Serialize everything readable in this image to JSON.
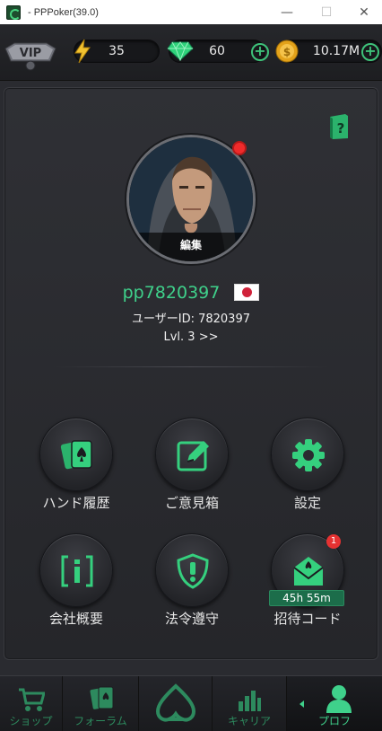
{
  "window": {
    "title": "- PPPoker(39.0)",
    "minimize_glyph": "—",
    "maximize_glyph": "☐",
    "close_glyph": "✕"
  },
  "resources": {
    "vip_label": "VIP",
    "energy": "35",
    "gems": "60",
    "coins": "10.17M",
    "plus_glyph": "+"
  },
  "profile": {
    "edit_label": "編集",
    "username": "pp7820397",
    "country_flag": "japan-flag",
    "user_id": "ユーザーID: 7820397",
    "level": "Lvl. 3 >>"
  },
  "menu": {
    "items": [
      {
        "label": "ハンド履歴",
        "icon": "cards-icon"
      },
      {
        "label": "ご意見箱",
        "icon": "feedback-edit-icon"
      },
      {
        "label": "設定",
        "icon": "gear-icon"
      },
      {
        "label": "会社概要",
        "icon": "info-icon"
      },
      {
        "label": "法令遵守",
        "icon": "shield-alert-icon"
      },
      {
        "label": "招待コード",
        "icon": "invite-envelope-icon"
      }
    ],
    "invite_badge": "1",
    "invite_timer": "45h 55m"
  },
  "bottom_nav": {
    "items": [
      {
        "label": "ショップ",
        "icon": "cart-icon"
      },
      {
        "label": "フォーラム",
        "icon": "forum-cards-icon"
      },
      {
        "label": "",
        "icon": "spade-logo-icon"
      },
      {
        "label": "キャリア",
        "icon": "chart-bars-icon"
      },
      {
        "label": "プロフ",
        "icon": "profile-user-icon"
      }
    ],
    "active": "プロフ"
  },
  "colors": {
    "accent": "#3fd18b",
    "panel": "#2a2b30",
    "alert": "#ef2b2b"
  }
}
